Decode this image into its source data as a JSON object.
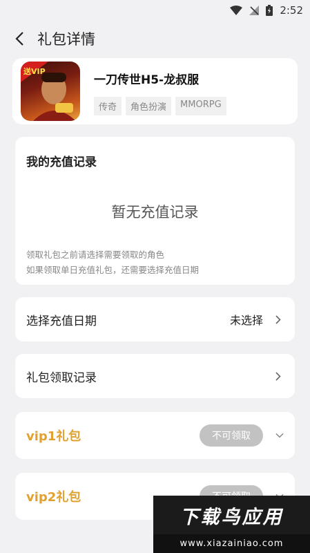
{
  "status_bar": {
    "time": "2:52"
  },
  "header": {
    "title": "礼包详情"
  },
  "game": {
    "name": "一刀传世H5-龙叔服",
    "badge": "送VIP",
    "tags": [
      "传奇",
      "角色扮演",
      "MMORPG"
    ]
  },
  "records": {
    "title": "我的充值记录",
    "empty": "暂无充值记录",
    "hint_line1": "领取礼包之前请选择需要领取的角色",
    "hint_line2": "如果领取单日充值礼包，还需要选择充值日期"
  },
  "recharge_date": {
    "label": "选择充值日期",
    "value": "未选择"
  },
  "claim_history": {
    "label": "礼包领取记录"
  },
  "gifts": [
    {
      "title": "vip1礼包",
      "status": "不可领取"
    },
    {
      "title": "vip2礼包",
      "status": "不可领取"
    }
  ],
  "watermark": {
    "brand": "下载鸟应用",
    "url": "www.xiazainiao.com"
  },
  "colors": {
    "accent": "#e2a12e",
    "background": "#f1f1f3",
    "pill": "#c2c2c2"
  }
}
